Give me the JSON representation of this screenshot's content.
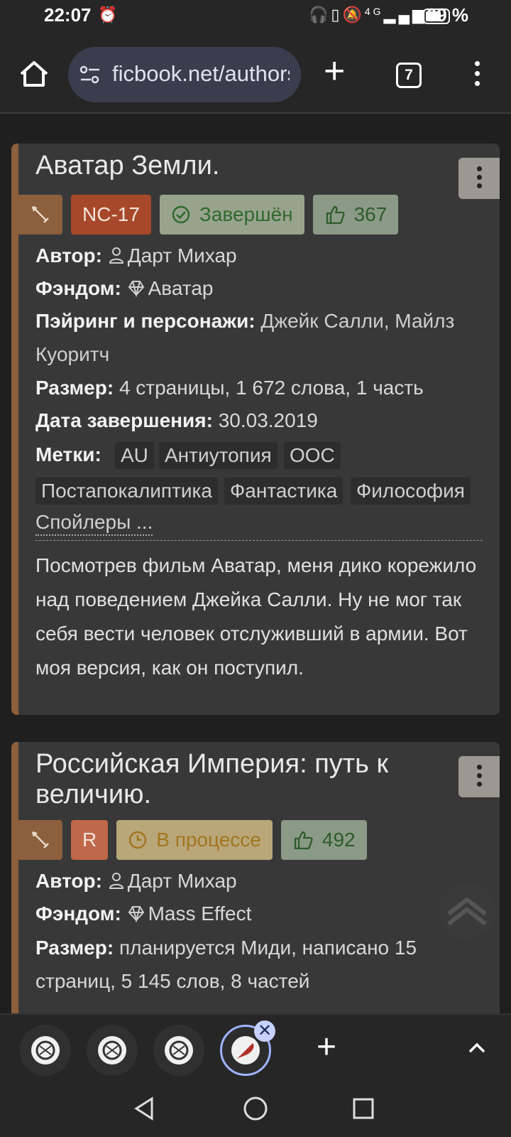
{
  "status_bar": {
    "time": "22:07",
    "network": "4G",
    "battery_percent": "69 %",
    "battery_level": 0.69
  },
  "browser": {
    "url": "ficbook.net/authors",
    "tab_count": "7"
  },
  "works": [
    {
      "title": "Аватар Земли.",
      "rating": "NC-17",
      "status": "Завершён",
      "likes": "367",
      "author_label": "Автор:",
      "author": "Дарт Михар",
      "fandom_label": "Фэндом:",
      "fandom": "Аватар",
      "pairing_label": "Пэйринг и персонажи:",
      "pairing_line1": "Джейк Салли, Майлз",
      "pairing_line2": "Куоритч",
      "size_label": "Размер:",
      "size": "4 страницы, 1 672 слова, 1 часть",
      "date_label": "Дата завершения:",
      "date": "30.03.2019",
      "tags_label": "Метки:",
      "tags": [
        "AU",
        "Антиутопия",
        "ООС",
        "Постапокалиптика",
        "Фантастика",
        "Философия"
      ],
      "spoilers": "Спойлеры ...",
      "description": "Посмотрев фильм Аватар, меня дико корежило над поведением Джейка Салли. Ну не мог так себя вести человек отслуживший в армии. Вот моя версия, как он поступил."
    },
    {
      "title": "Российская Империя: путь к величию.",
      "rating": "R",
      "status": "В процессе",
      "likes": "492",
      "author_label": "Автор:",
      "author": "Дарт Михар",
      "fandom_label": "Фэндом:",
      "fandom": "Mass Effect",
      "size_label": "Размер:",
      "size_line1": "планируется Миди, написано 15",
      "size_line2": "страниц, 5 145 слов, 8 частей"
    }
  ],
  "colors": {
    "accent_stripe": "#8c5f3d",
    "rating_nc17": "#a8482a",
    "rating_r": "#c0684a",
    "status_done": "#98a38d",
    "status_progress": "#b9a77a",
    "likes": "#8b9a86"
  }
}
